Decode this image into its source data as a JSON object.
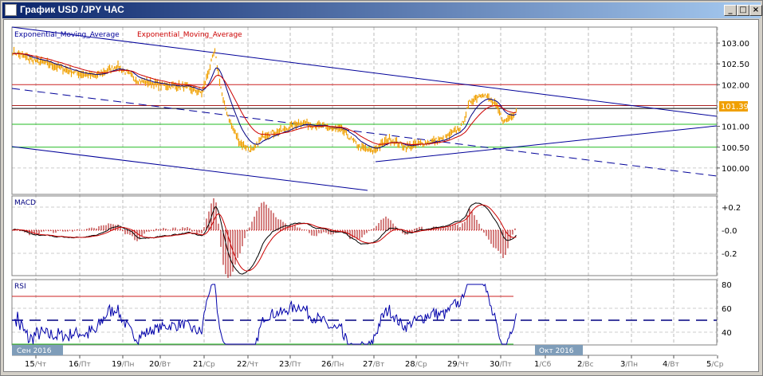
{
  "window": {
    "title": "График USD /JPY  ЧАС",
    "minimize": "_",
    "maximize": "□",
    "close": "×"
  },
  "legend": {
    "ema_blue": "Exponential_Moving_Average",
    "ema_red": "Exponential_Moving_Average"
  },
  "colors": {
    "price": "#f0a000",
    "ema_fast": "#000080",
    "ema_slow": "#cc0000",
    "trend": "#000099",
    "green": "#22bb22",
    "red": "#cc2222",
    "month_badge": "#7f9db9"
  },
  "chart_data": [
    {
      "type": "line",
      "title": "USD/JPY H1",
      "current_price": "101.39",
      "y_ticks": [
        "103.00",
        "102.50",
        "102.00",
        "101.00",
        "100.50",
        "100.00"
      ],
      "ylim": [
        99.6,
        103.5
      ],
      "price_points": [
        [
          -0.55,
          102.8
        ],
        [
          -0.1,
          102.6
        ],
        [
          0.3,
          102.5
        ],
        [
          0.9,
          102.3
        ],
        [
          1.4,
          102.2
        ],
        [
          1.9,
          102.45
        ],
        [
          2.4,
          102.1
        ],
        [
          2.9,
          102.0
        ],
        [
          3.5,
          101.95
        ],
        [
          3.9,
          101.8
        ],
        [
          4.2,
          102.8
        ],
        [
          4.4,
          101.6
        ],
        [
          4.6,
          101.0
        ],
        [
          4.8,
          100.6
        ],
        [
          5.1,
          100.4
        ],
        [
          5.35,
          100.8
        ],
        [
          5.8,
          100.9
        ],
        [
          6.2,
          101.1
        ],
        [
          6.7,
          101.0
        ],
        [
          7.2,
          100.9
        ],
        [
          7.6,
          100.5
        ],
        [
          7.9,
          100.4
        ],
        [
          8.3,
          100.7
        ],
        [
          8.7,
          100.5
        ],
        [
          9.1,
          100.6
        ],
        [
          9.6,
          100.7
        ],
        [
          10.0,
          101.0
        ],
        [
          10.2,
          101.6
        ],
        [
          10.5,
          101.8
        ],
        [
          10.8,
          101.5
        ],
        [
          11.0,
          101.1
        ],
        [
          11.2,
          101.3
        ],
        [
          11.3,
          101.39
        ]
      ],
      "levels": [
        102.0,
        101.5,
        101.43,
        101.05,
        100.5
      ]
    },
    {
      "type": "line",
      "title": "MACD",
      "y_ticks": [
        "+0.2",
        "-0.0",
        "-0.2"
      ],
      "ylim": [
        -0.3,
        0.3
      ]
    },
    {
      "type": "line",
      "title": "RSI",
      "y_ticks": [
        "80",
        "60",
        "40"
      ],
      "ylim": [
        28,
        82
      ],
      "levels": [
        70,
        50,
        30
      ]
    }
  ],
  "x_axis": {
    "month_left": "Сен 2016",
    "month_right": "Окт 2016",
    "days": [
      {
        "num": "15",
        "dow": "Чт"
      },
      {
        "num": "16",
        "dow": "Пт"
      },
      {
        "num": "19",
        "dow": "Пн"
      },
      {
        "num": "20",
        "dow": "Вт"
      },
      {
        "num": "21",
        "dow": "Ср"
      },
      {
        "num": "22",
        "dow": "Чт"
      },
      {
        "num": "23",
        "dow": "Пт"
      },
      {
        "num": "26",
        "dow": "Пн"
      },
      {
        "num": "27",
        "dow": "Вт"
      },
      {
        "num": "28",
        "dow": "Ср"
      },
      {
        "num": "29",
        "dow": "Чт"
      },
      {
        "num": "30",
        "dow": "Пт"
      },
      {
        "num": "1",
        "dow": "Сб"
      },
      {
        "num": "2",
        "dow": "Вс"
      },
      {
        "num": "3",
        "dow": "Пн"
      },
      {
        "num": "4",
        "dow": "Вт"
      },
      {
        "num": "5",
        "dow": "Ср"
      }
    ]
  }
}
